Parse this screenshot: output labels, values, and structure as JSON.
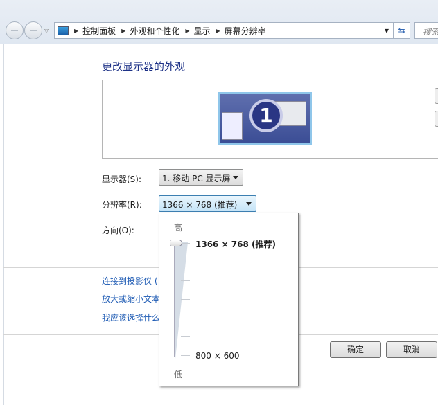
{
  "nav": {
    "breadcrumbs": [
      "控制面板",
      "外观和个性化",
      "显示",
      "屏幕分辨率"
    ],
    "search_placeholder": "搜索"
  },
  "main": {
    "title": "更改显示器的外观",
    "monitor_number": "1",
    "display_label": "显示器(S):",
    "display_value": "1. 移动 PC 显示屏",
    "resolution_label": "分辨率(R):",
    "resolution_value": "1366 × 768 (推荐)",
    "orientation_label": "方向(O):",
    "links": [
      "连接到投影仪 (",
      "放大或缩小文本",
      "我应该选择什么"
    ],
    "ok_label": "确定",
    "cancel_label": "取消"
  },
  "popup": {
    "high_label": "高",
    "low_label": "低",
    "max_label": "1366 × 768 (推荐)",
    "min_label": "800 × 600",
    "slider_position": 1.0
  }
}
